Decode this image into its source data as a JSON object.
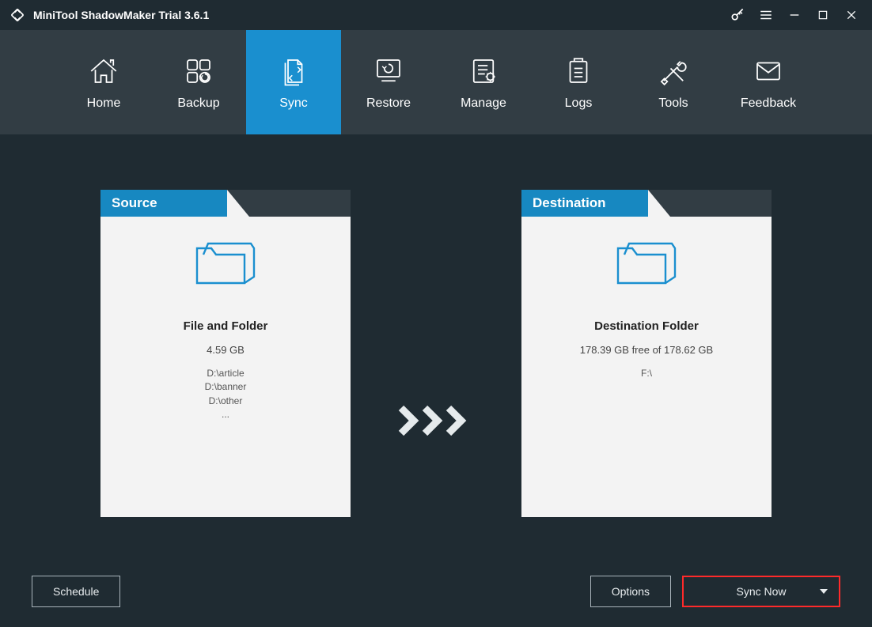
{
  "title": "MiniTool ShadowMaker Trial 3.6.1",
  "nav": {
    "home": "Home",
    "backup": "Backup",
    "sync": "Sync",
    "restore": "Restore",
    "manage": "Manage",
    "logs": "Logs",
    "tools": "Tools",
    "feedback": "Feedback"
  },
  "source": {
    "header": "Source",
    "title": "File and Folder",
    "size": "4.59 GB",
    "items": [
      "D:\\article",
      "D:\\banner",
      "D:\\other",
      "..."
    ]
  },
  "destination": {
    "header": "Destination",
    "title": "Destination Folder",
    "free": "178.39 GB free of 178.62 GB",
    "path": "F:\\"
  },
  "footer": {
    "schedule": "Schedule",
    "options": "Options",
    "syncnow": "Sync Now"
  }
}
